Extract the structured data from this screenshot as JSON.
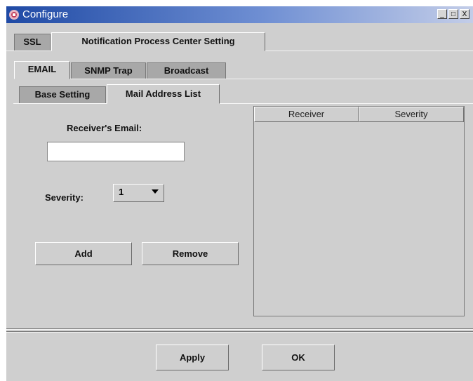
{
  "window": {
    "title": "Configure",
    "controls": {
      "minimize": "_",
      "maximize": "□",
      "close": "X"
    }
  },
  "tabs_level1": [
    {
      "label": "SSL",
      "active": false
    },
    {
      "label": "Notification Process Center Setting",
      "active": true
    }
  ],
  "tabs_level2": [
    {
      "label": "EMAIL",
      "active": true
    },
    {
      "label": "SNMP Trap",
      "active": false
    },
    {
      "label": "Broadcast",
      "active": false
    }
  ],
  "tabs_level3": [
    {
      "label": "Base Setting",
      "active": false
    },
    {
      "label": "Mail Address List",
      "active": true
    }
  ],
  "form": {
    "receiver_email_label": "Receiver's Email:",
    "receiver_email_value": "",
    "severity_label": "Severity:",
    "severity_value": "1",
    "add_label": "Add",
    "remove_label": "Remove"
  },
  "table": {
    "columns": [
      "Receiver",
      "Severity"
    ],
    "rows": []
  },
  "footer": {
    "apply_label": "Apply",
    "ok_label": "OK"
  },
  "colors": {
    "titlebar_start": "#1f4aa5",
    "window_bg": "#cfcfcf",
    "inactive_tab": "#a8a8a8"
  }
}
